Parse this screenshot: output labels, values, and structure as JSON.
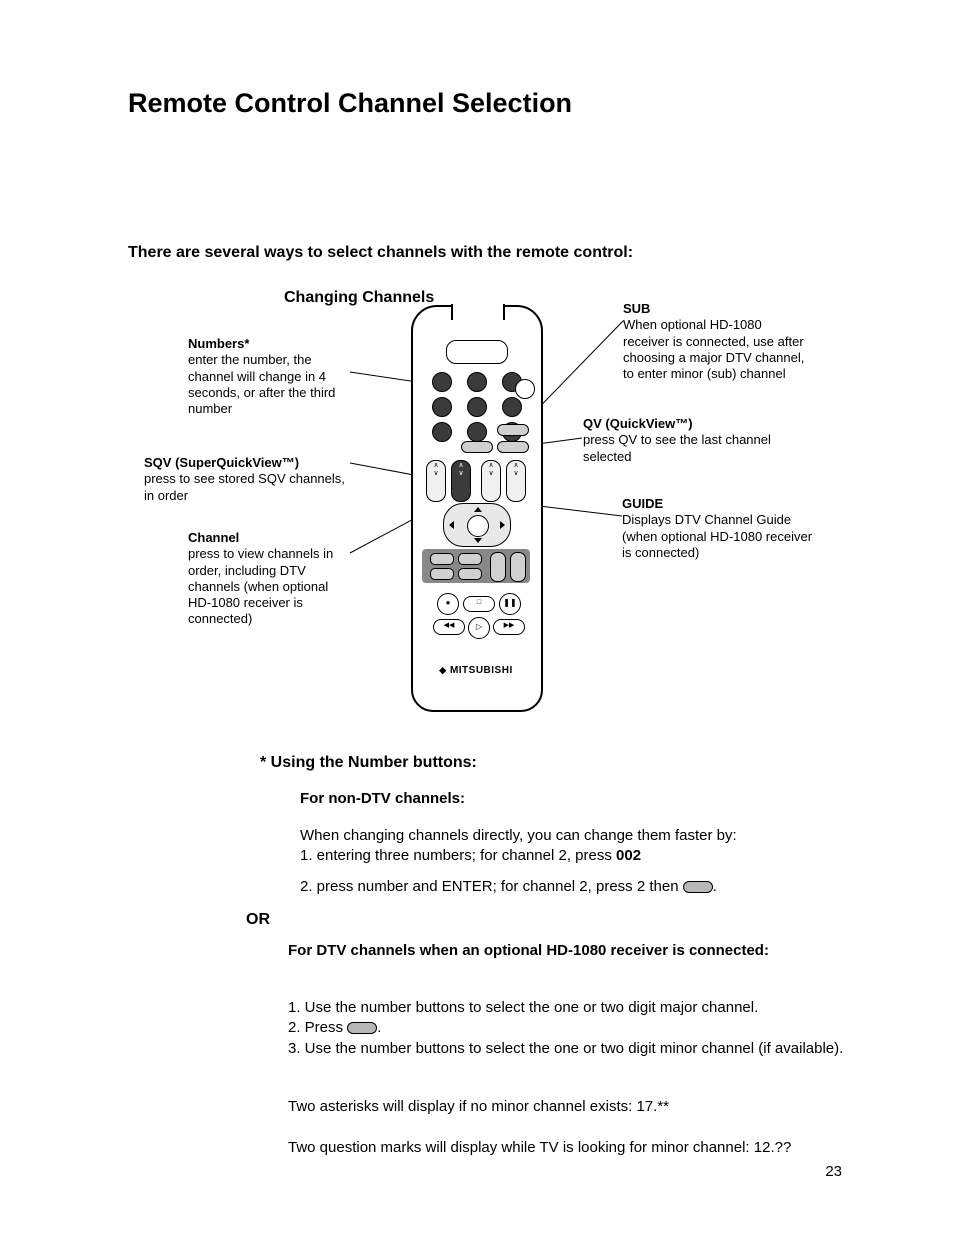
{
  "title": "Remote Control Channel Selection",
  "intro": "There are several ways to select channels with the remote control:",
  "diagram_title": "Changing Channels",
  "callouts": {
    "numbers": {
      "heading": "Numbers*",
      "body": "enter the number, the channel will change in 4 seconds, or after the third number"
    },
    "sqv": {
      "heading": "SQV (SuperQuickView™)",
      "body": "press to see stored SQV channels, in order"
    },
    "channel": {
      "heading": "Channel",
      "body": "press to view channels in order, including DTV channels (when optional HD-1080 receiver is connected)"
    },
    "sub": {
      "heading": "SUB",
      "body": "When optional HD-1080 receiver is connected, use after choosing  a major DTV channel, to enter minor (sub) channel"
    },
    "qv": {
      "heading": "QV (QuickView™)",
      "body": "press QV to see the last channel selected"
    },
    "guide": {
      "heading": "GUIDE",
      "body": "Displays DTV Channel Guide (when optional HD-1080 receiver is connected)"
    }
  },
  "remote_brand": "MITSUBISHI",
  "using_heading": "* Using the Number buttons:",
  "nondtv_heading": "For non-DTV channels:",
  "nondtv_lead": "When changing channels directly, you can change them faster by:",
  "nondtv_item1_pre": "1.  entering three numbers;  for channel 2, press ",
  "nondtv_item1_bold": "002",
  "nondtv_item2_pre": "2.  press number and ENTER;  for channel 2, press 2 then ",
  "nondtv_item2_post": ".",
  "or": "OR",
  "dtv_heading": "For DTV channels when an optional HD-1080 receiver is connected:",
  "dtv_item1": "1.  Use the number buttons to select the one or two digit major channel.",
  "dtv_item2_pre": "2.  Press ",
  "dtv_item2_post": ".",
  "dtv_item3": "3.  Use the number buttons to select the one or two digit minor channel (if available).",
  "note_asterisks": "Two asterisks will display if no minor channel exists:  17.**",
  "note_qmarks": "Two question marks will display while TV is looking for minor channel: 12.??",
  "page_number": "23"
}
